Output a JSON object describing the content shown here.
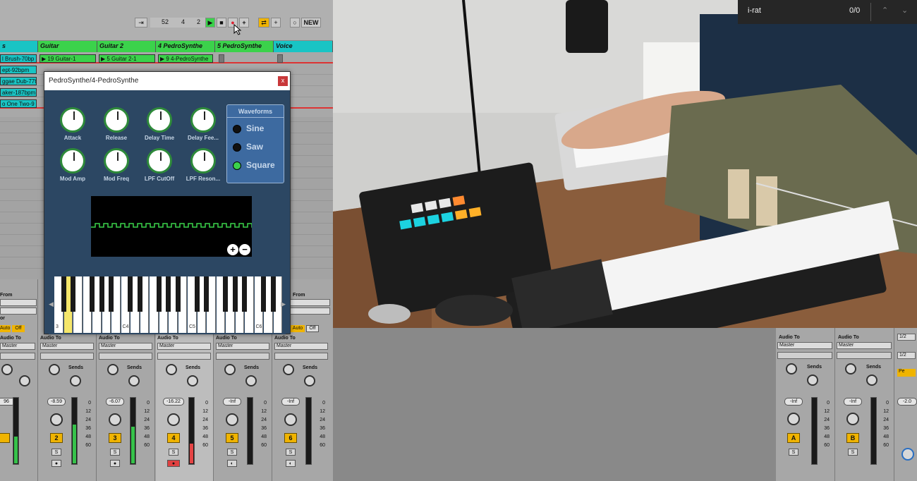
{
  "transport": {
    "bar": "52",
    "beat": "4",
    "sixteenth": "2",
    "new_label": "NEW"
  },
  "tracks": [
    {
      "name": "s",
      "color": "#19c4c4"
    },
    {
      "name": "Guitar",
      "color": "#3bd24b"
    },
    {
      "name": "Guitar 2",
      "color": "#3bd24b"
    },
    {
      "name": "4 PedroSynthe",
      "color": "#3bd24b"
    },
    {
      "name": "5 PedroSynthe",
      "color": "#3bd24b"
    },
    {
      "name": "Voice",
      "color": "#19c4c4"
    }
  ],
  "clips": {
    "col0": [
      "l Brush-70bp",
      "ept-92bpm",
      "ggae Dub-77t",
      "aker-187bpm",
      "o One Two-9"
    ],
    "guitar": "19 Guitar-1",
    "guitar2": "5 Guitar 2-1",
    "synth": "9 4-PedroSynthe"
  },
  "plugin": {
    "title": "PedroSynthe/4-PedroSynthe",
    "close": "x",
    "knobs": [
      "Attack",
      "Release",
      "Delay Time",
      "Delay Fee...",
      "Mod Amp",
      "Mod Freq",
      "LPF CutOff",
      "LPF Reson..."
    ],
    "waveforms_title": "Waveforms",
    "waveforms": [
      "Sine",
      "Saw",
      "Square"
    ],
    "selected_waveform": "Square",
    "zoom_in": "+",
    "zoom_out": "−",
    "key_labels": [
      "C4",
      "C5",
      "C6"
    ],
    "key_c3": "3"
  },
  "mixer": {
    "audio_to": "Audio To",
    "master": "Master",
    "sends": "Sends",
    "from": "From",
    "auto": "Auto",
    "off": "Off",
    "or": "or",
    "channels": [
      {
        "num": "",
        "vol": "96"
      },
      {
        "num": "2",
        "vol": "-8.59"
      },
      {
        "num": "3",
        "vol": "-6.07"
      },
      {
        "num": "4",
        "vol": "-16.22"
      },
      {
        "num": "5",
        "vol": "-Inf"
      },
      {
        "num": "6",
        "vol": "-Inf"
      }
    ],
    "returns": [
      {
        "num": "A",
        "vol": "-Inf"
      },
      {
        "num": "B",
        "vol": "-Inf"
      }
    ],
    "master_vol": "-2.0",
    "half": "1/2",
    "s_label": "S",
    "a_label": "A",
    "b_label": "B",
    "scale": [
      "0",
      "12",
      "24",
      "36",
      "48",
      "60"
    ],
    "row_nums": [
      "5",
      "6"
    ],
    "cue_label": "Pe"
  },
  "findbar": {
    "query": "i-rat",
    "count": "0/0"
  }
}
